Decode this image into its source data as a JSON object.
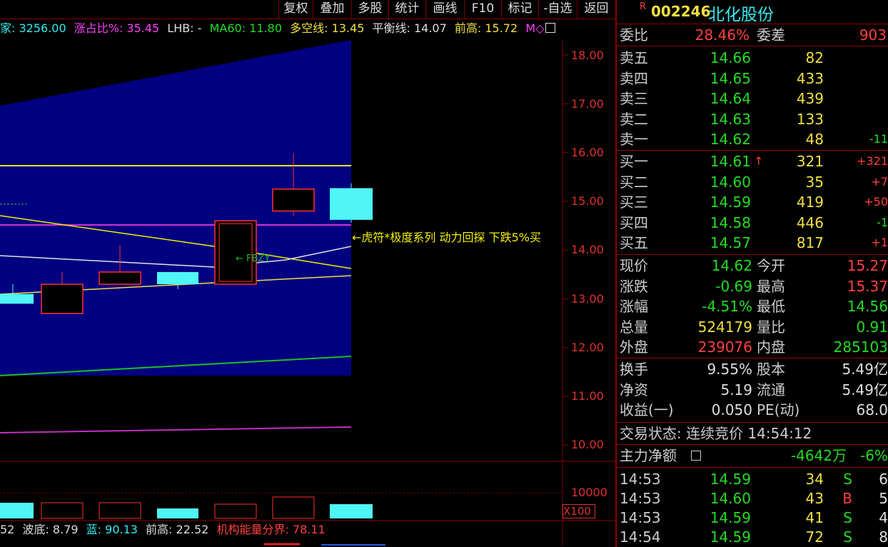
{
  "toolbar": {
    "buttons": [
      "复权",
      "叠加",
      "多股",
      "统计",
      "画线",
      "F10",
      "标记",
      "-自选",
      "返回"
    ]
  },
  "indicator_line": {
    "seg1": "家: 3256.00",
    "seg2": "涨占比%: 35.45",
    "seg3": "LHB: -",
    "seg4": "MA60: 11.80",
    "seg5": "多空线: 13.45",
    "seg6": "平衡线: 14.07",
    "seg7": "前高: 15.72",
    "seg8": "M◇"
  },
  "chart": {
    "price_labels": [
      "18.00",
      "17.00",
      "16.00",
      "15.00",
      "14.00",
      "13.00",
      "12.00",
      "11.00",
      "10.00"
    ],
    "annotation": "←虎符*极度系列 动力回探 下跌5%买",
    "small_note": "← FBZY",
    "volume_label": "10000",
    "volume_unit": "X100",
    "candles": [
      {
        "o": 13.1,
        "c": 12.9,
        "h": 13.3,
        "l": 12.9,
        "color": "cyan"
      },
      {
        "o": 12.7,
        "c": 13.3,
        "h": 13.55,
        "l": 12.7,
        "color": "red"
      },
      {
        "o": 13.3,
        "c": 13.55,
        "h": 14.1,
        "l": 13.3,
        "color": "red"
      },
      {
        "o": 13.55,
        "c": 13.3,
        "h": 13.55,
        "l": 13.2,
        "color": "cyan"
      },
      {
        "o": 13.3,
        "c": 14.6,
        "h": 14.6,
        "l": 13.3,
        "color": "red"
      },
      {
        "o": 14.8,
        "c": 15.25,
        "h": 15.98,
        "l": 14.7,
        "color": "red"
      },
      {
        "o": 15.27,
        "c": 14.62,
        "h": 15.37,
        "l": 14.56,
        "color": "cyan"
      }
    ]
  },
  "bottom_line": {
    "seg1": "52",
    "seg2": "波底: 8.79",
    "seg3": "蓝: 90.13",
    "seg4": "前高: 22.52",
    "seg5": "机构能量分界: 78.11"
  },
  "stock": {
    "marker": "R",
    "code": "002246",
    "name": "北化股份"
  },
  "weibi": {
    "label1": "委比",
    "val1": "28.46%",
    "label2": "委差",
    "val2": "903"
  },
  "sell": [
    {
      "label": "卖五",
      "price": "14.66",
      "vol": "82",
      "chg": ""
    },
    {
      "label": "卖四",
      "price": "14.65",
      "vol": "433",
      "chg": ""
    },
    {
      "label": "卖三",
      "price": "14.64",
      "vol": "439",
      "chg": ""
    },
    {
      "label": "卖二",
      "price": "14.63",
      "vol": "133",
      "chg": ""
    },
    {
      "label": "卖一",
      "price": "14.62",
      "vol": "48",
      "chg": "-11"
    }
  ],
  "buy": [
    {
      "label": "买一",
      "price": "14.61",
      "vol": "321",
      "chg": "+321",
      "arrow": "↑"
    },
    {
      "label": "买二",
      "price": "14.60",
      "vol": "35",
      "chg": "+7",
      "arrow": ""
    },
    {
      "label": "买三",
      "price": "14.59",
      "vol": "419",
      "chg": "+50",
      "arrow": ""
    },
    {
      "label": "买四",
      "price": "14.58",
      "vol": "446",
      "chg": "-1",
      "arrow": ""
    },
    {
      "label": "买五",
      "price": "14.57",
      "vol": "817",
      "chg": "+1",
      "arrow": ""
    }
  ],
  "stats": [
    {
      "l1": "现价",
      "v1": "14.62",
      "l2": "今开",
      "v2": "15.27"
    },
    {
      "l1": "涨跌",
      "v1": "-0.69",
      "l2": "最高",
      "v2": "15.37"
    },
    {
      "l1": "涨幅",
      "v1": "-4.51%",
      "l2": "最低",
      "v2": "14.56"
    },
    {
      "l1": "总量",
      "v1": "524179",
      "l2": "量比",
      "v2": "0.91"
    },
    {
      "l1": "外盘",
      "v1": "239076",
      "l2": "内盘",
      "v2": "285103"
    }
  ],
  "stats2": [
    {
      "l1": "换手",
      "v1": "9.55%",
      "l2": "股本",
      "v2": "5.49亿"
    },
    {
      "l1": "净资",
      "v1": "5.19",
      "l2": "流通",
      "v2": "5.49亿"
    },
    {
      "l1": "收益(一)",
      "v1": "0.050",
      "l2": "PE(动)",
      "v2": "68.0"
    }
  ],
  "trade_status": "交易状态: 连续竞价 14:54:12",
  "main_flow": {
    "label": "主力净额",
    "value": "-4642万",
    "pct": "-6%"
  },
  "ticks": [
    {
      "time": "14:53",
      "price": "14.59",
      "vol": "34",
      "side": "S",
      "num": "6"
    },
    {
      "time": "14:53",
      "price": "14.60",
      "vol": "43",
      "side": "B",
      "num": "5"
    },
    {
      "time": "14:53",
      "price": "14.59",
      "vol": "41",
      "side": "S",
      "num": "4"
    },
    {
      "time": "14:54",
      "price": "14.59",
      "vol": "72",
      "side": "S",
      "num": "8"
    }
  ]
}
